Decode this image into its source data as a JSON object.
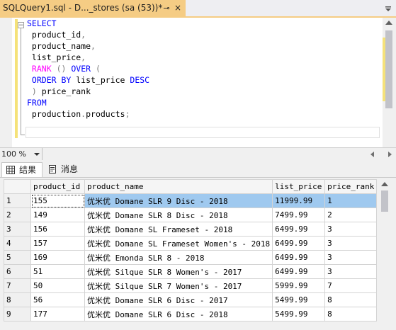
{
  "tab": {
    "title": "SQLQuery1.sql - D..._stores (sa (53))*",
    "pin_glyph": "⊸",
    "close_glyph": "×"
  },
  "editor": {
    "lines": [
      [
        {
          "t": "SELECT",
          "c": "kw"
        }
      ],
      [
        {
          "t": " product_id",
          "c": ""
        },
        {
          "t": ",",
          "c": "gr"
        }
      ],
      [
        {
          "t": " product_name",
          "c": ""
        },
        {
          "t": ",",
          "c": "gr"
        }
      ],
      [
        {
          "t": " list_price",
          "c": ""
        },
        {
          "t": ",",
          "c": "gr"
        }
      ],
      [
        {
          "t": " RANK",
          "c": "fn"
        },
        {
          "t": " ",
          "c": ""
        },
        {
          "t": "()",
          "c": "gr"
        },
        {
          "t": " OVER",
          "c": "kw"
        },
        {
          "t": " (",
          "c": "gr"
        }
      ],
      [
        {
          "t": " ORDER BY",
          "c": "kw"
        },
        {
          "t": " list_price ",
          "c": ""
        },
        {
          "t": "DESC",
          "c": "kw"
        }
      ],
      [
        {
          "t": " ) ",
          "c": "gr"
        },
        {
          "t": "price_rank",
          "c": ""
        }
      ],
      [
        {
          "t": "FROM",
          "c": "kw"
        }
      ],
      [
        {
          "t": " production",
          "c": ""
        },
        {
          "t": ".",
          "c": "gr"
        },
        {
          "t": "products",
          "c": ""
        },
        {
          "t": ";",
          "c": "gr"
        }
      ]
    ]
  },
  "zoom": {
    "value": "100 %"
  },
  "results_tabs": [
    {
      "label": "结果"
    },
    {
      "label": "消息"
    }
  ],
  "grid": {
    "columns": [
      "",
      "product_id",
      "product_name",
      "list_price",
      "price_rank"
    ],
    "rows": [
      [
        "1",
        "155",
        "优米优 Domane SLR 9 Disc - 2018",
        "11999.99",
        "1"
      ],
      [
        "2",
        "149",
        "优米优 Domane SLR 8 Disc - 2018",
        "7499.99",
        "2"
      ],
      [
        "3",
        "156",
        "优米优 Domane SL Frameset - 2018",
        "6499.99",
        "3"
      ],
      [
        "4",
        "157",
        "优米优 Domane SL Frameset Women's - 2018",
        "6499.99",
        "3"
      ],
      [
        "5",
        "169",
        "优米优 Emonda SLR 8 - 2018",
        "6499.99",
        "3"
      ],
      [
        "6",
        "51",
        "优米优 Silque SLR 8 Women's - 2017",
        "6499.99",
        "3"
      ],
      [
        "7",
        "50",
        "优米优 Silque SLR 7 Women's - 2017",
        "5999.99",
        "7"
      ],
      [
        "8",
        "56",
        "优米优 Domane SLR 6 Disc - 2017",
        "5499.99",
        "8"
      ],
      [
        "9",
        "177",
        "优米优 Domane SLR 6 Disc - 2018",
        "5499.99",
        "8"
      ]
    ]
  },
  "colors": {
    "tab_accent": "#f5cc84",
    "keyword": "#0000ff",
    "function": "#ff00ff",
    "selected_row": "#9fc9ef"
  }
}
